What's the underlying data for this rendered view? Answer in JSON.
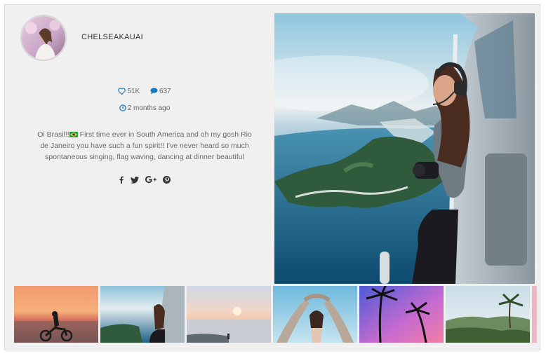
{
  "post": {
    "username": "CHELSEAKAUAI",
    "likes": "51K",
    "comments": "637",
    "time_ago": "2 months ago",
    "caption_start": "Oi Brasil!!",
    "caption_rest": " First time ever in South America and oh my gosh Rio de Janeiro you have such a fun spirit!! I've never heard so much spontaneous singing, flag waving, dancing at dinner beautiful"
  },
  "share": [
    "facebook-icon",
    "twitter-icon",
    "google-plus-icon",
    "pinterest-icon"
  ],
  "colors": {
    "accent": "#1b78c2",
    "background": "#f0f0f0"
  },
  "thumbnails": [
    {
      "name": "sunset-motorbike"
    },
    {
      "name": "helicopter-rio",
      "active": true
    },
    {
      "name": "beach-sunset"
    },
    {
      "name": "swing-beach"
    },
    {
      "name": "palm-trees-pink"
    },
    {
      "name": "palm-jungle"
    }
  ]
}
